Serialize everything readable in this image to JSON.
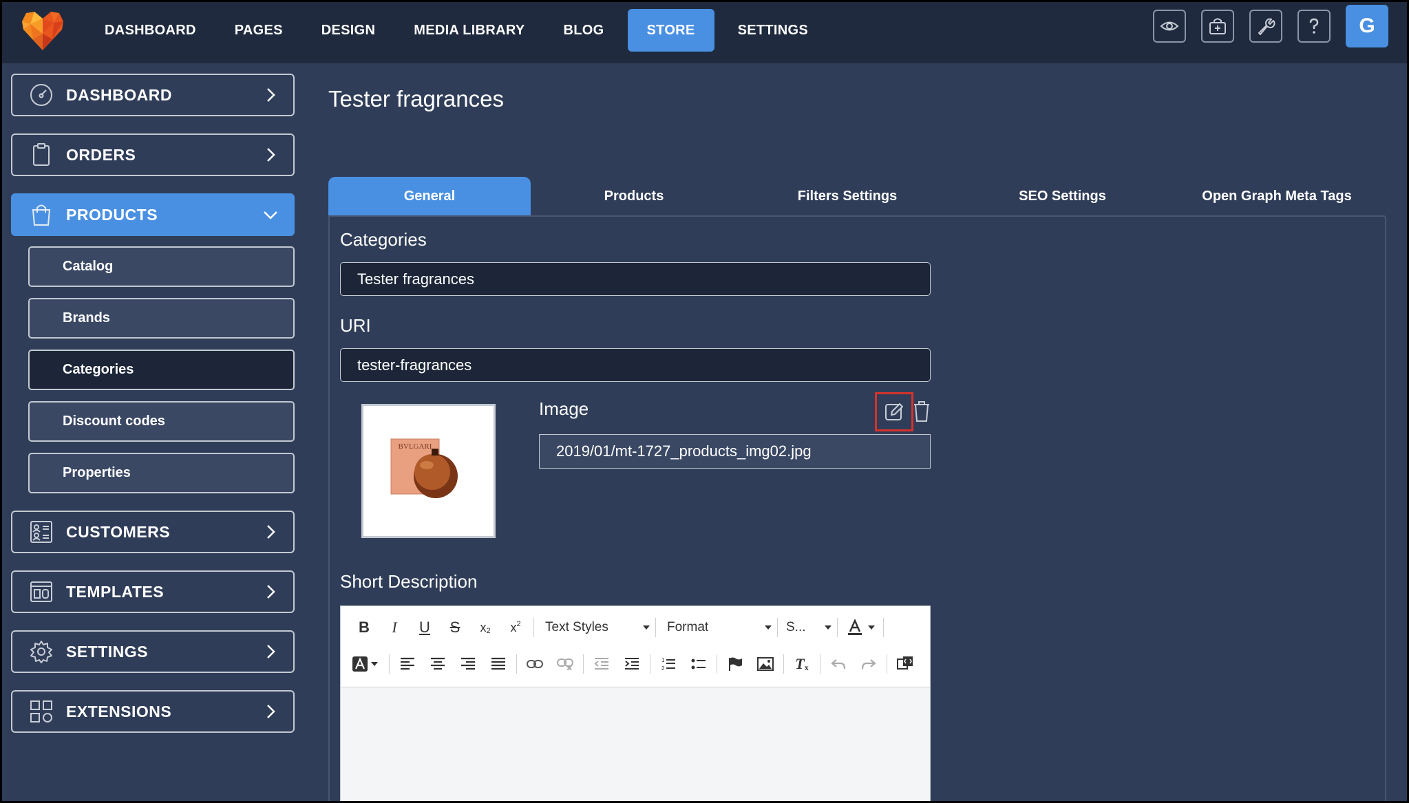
{
  "topbar": {
    "nav": [
      "DASHBOARD",
      "PAGES",
      "DESIGN",
      "MEDIA LIBRARY",
      "BLOG",
      "STORE",
      "SETTINGS"
    ],
    "active_nav": "STORE",
    "avatar_letter": "G",
    "action_icons": [
      "eye-icon",
      "store-icon",
      "wrench-icon",
      "help-icon"
    ]
  },
  "sidebar": {
    "items": [
      {
        "label": "DASHBOARD",
        "icon": "gauge-icon"
      },
      {
        "label": "ORDERS",
        "icon": "clipboard-icon"
      },
      {
        "label": "PRODUCTS",
        "icon": "bag-icon"
      },
      {
        "label": "CUSTOMERS",
        "icon": "contacts-icon"
      },
      {
        "label": "TEMPLATES",
        "icon": "template-icon"
      },
      {
        "label": "SETTINGS",
        "icon": "gear-icon"
      },
      {
        "label": "EXTENSIONS",
        "icon": "grid-icon"
      }
    ],
    "products_sub": [
      "Catalog",
      "Brands",
      "Categories",
      "Discount codes",
      "Properties"
    ],
    "active_sub": "Categories"
  },
  "main": {
    "title": "Tester fragrances",
    "tabs": [
      "General",
      "Products",
      "Filters Settings",
      "SEO Settings",
      "Open Graph Meta Tags"
    ],
    "active_tab": "General",
    "categories_label": "Categories",
    "categories_value": "Tester fragrances",
    "uri_label": "URI",
    "uri_value": "tester-fragrances",
    "image_label": "Image",
    "image_path": "2019/01/mt-1727_products_img02.jpg",
    "image_brand_text": "BVLGARI",
    "short_description_label": "Short Description"
  },
  "editor": {
    "text_styles": "Text Styles",
    "format": "Format",
    "size": "S..."
  },
  "colors": {
    "accent": "#4a90e2",
    "background": "#2f3d58",
    "topbar": "#1f2a3e",
    "highlight": "#d6322b"
  }
}
